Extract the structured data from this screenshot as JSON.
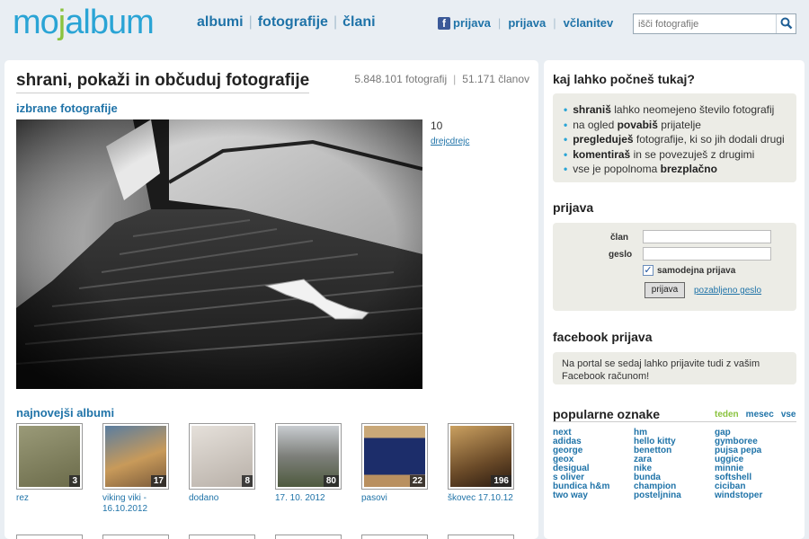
{
  "header": {
    "logo": {
      "mo": "mo",
      "j": "j",
      "album": "album"
    },
    "nav": [
      "albumi",
      "fotografije",
      "člani"
    ],
    "user_nav": {
      "fb_login": "prijava",
      "login": "prijava",
      "register": "včlanitev"
    },
    "search_placeholder": "išči fotografije"
  },
  "main": {
    "title": "shrani, pokaži in občuduj fotografije",
    "photo_count": "5.848.101 fotografij",
    "member_count": "51.171 članov",
    "featured_heading": "izbrane fotografije",
    "featured_count": "10",
    "featured_user": "drejcdrejc",
    "albums_heading": "najnovejši albumi",
    "albums": [
      {
        "name": "rez",
        "count": "3",
        "color": "#7b7b5a"
      },
      {
        "name": "viking viki - 16.10.2012",
        "count": "17",
        "color": "#b58a5a"
      },
      {
        "name": "dodano",
        "count": "8",
        "color": "#c9c3bc"
      },
      {
        "name": "17. 10. 2012",
        "count": "80",
        "color": "#8a8a86"
      },
      {
        "name": "pasovi",
        "count": "22",
        "color": "#1f2f6a"
      },
      {
        "name": "škovec 17.10.12",
        "count": "196",
        "color": "#7a5a30"
      }
    ]
  },
  "sidebar": {
    "what_heading": "kaj lahko počneš tukaj?",
    "features": [
      {
        "bold": "shraniš",
        "text": " lahko neomejeno število fotografij",
        "bold_first": true
      },
      {
        "pre": "na ogled ",
        "bold": "povabiš",
        "text": " prijatelje"
      },
      {
        "bold": "pregleduješ",
        "text": " fotografije, ki so jih dodali drugi",
        "bold_first": true
      },
      {
        "bold": "komentiraš",
        "text": " in se povezuješ z drugimi",
        "bold_first": true
      },
      {
        "pre": "vse je popolnoma ",
        "bold": "brezplačno",
        "text": ""
      }
    ],
    "login_heading": "prijava",
    "login": {
      "member_label": "član",
      "password_label": "geslo",
      "remember_label": "samodejna prijava",
      "remember_checked": true,
      "button": "prijava",
      "forgot": "pozabljeno geslo"
    },
    "fb_heading": "facebook prijava",
    "fb_text": "Na portal se sedaj lahko prijavite tudi z vašim Facebook računom!",
    "tags_heading": "popularne oznake",
    "tag_tabs": [
      "teden",
      "mesec",
      "vse"
    ],
    "tags": [
      [
        "next",
        "adidas",
        "george",
        "geox",
        "desigual",
        "s oliver",
        "bundica h&m",
        "two way"
      ],
      [
        "hm",
        "hello kitty",
        "benetton",
        "zara",
        "nike",
        "bunda",
        "champion",
        "posteljnina"
      ],
      [
        "gap",
        "gymboree",
        "pujsa pepa",
        "uggice",
        "minnie",
        "softshell",
        "ciciban",
        "windstoper"
      ]
    ]
  }
}
